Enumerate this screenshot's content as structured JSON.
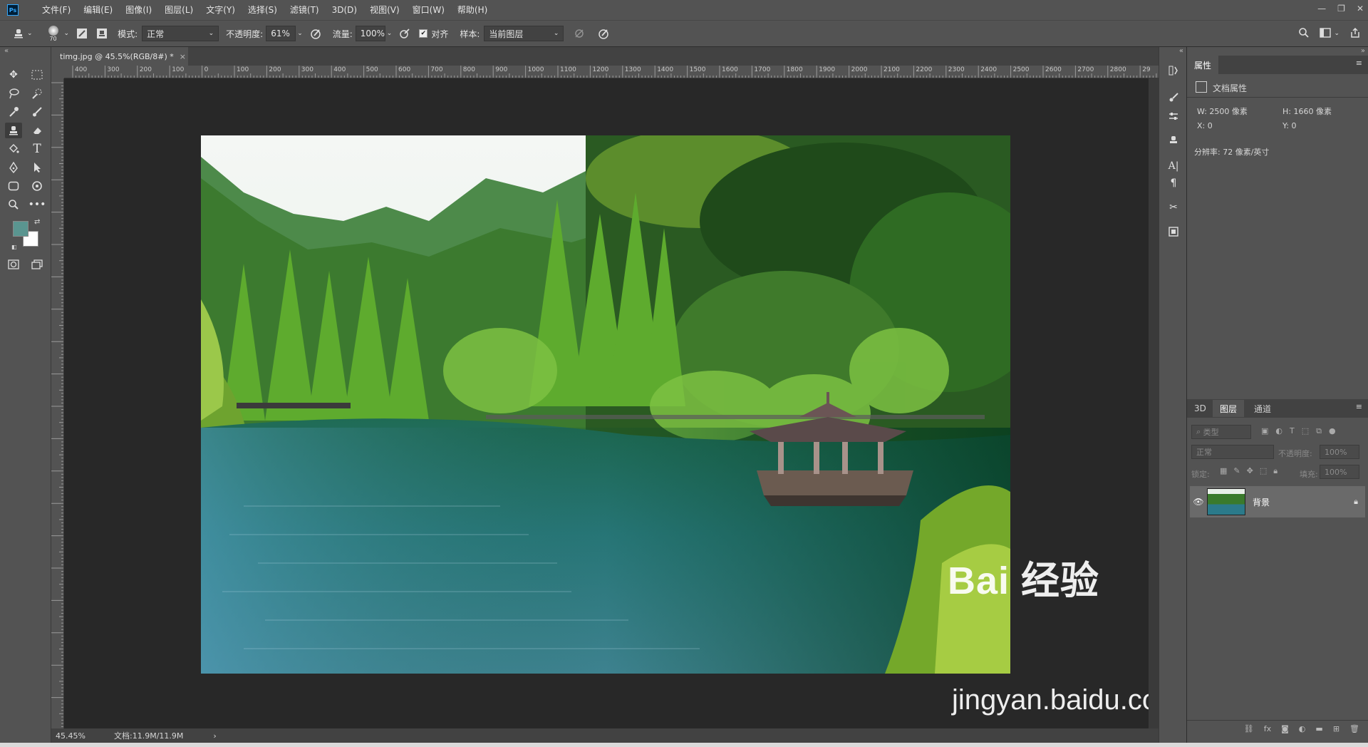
{
  "app": {
    "logo": "Ps"
  },
  "menu": [
    "文件(F)",
    "编辑(E)",
    "图像(I)",
    "图层(L)",
    "文字(Y)",
    "选择(S)",
    "滤镜(T)",
    "3D(D)",
    "视图(V)",
    "窗口(W)",
    "帮助(H)"
  ],
  "options": {
    "brush_size": "70",
    "mode_label": "模式:",
    "mode_value": "正常",
    "opacity_label": "不透明度:",
    "opacity_value": "61%",
    "flow_label": "流量:",
    "flow_value": "100%",
    "align_label": "对齐",
    "sample_label": "样本:",
    "sample_value": "当前图层"
  },
  "document": {
    "tab_title": "timg.jpg @ 45.5%(RGB/8#) *",
    "close": "×"
  },
  "ruler_top": [
    "400",
    "300",
    "200",
    "100",
    "0",
    "100",
    "200",
    "300",
    "400",
    "500",
    "600",
    "700",
    "800",
    "900",
    "1000",
    "1100",
    "1200",
    "1300",
    "1400",
    "1500",
    "1600",
    "1700",
    "1800",
    "1900",
    "2000",
    "2100",
    "2200",
    "2300",
    "2400",
    "2500",
    "2600",
    "2700",
    "2800",
    "29"
  ],
  "status": {
    "zoom": "45.45%",
    "doc_info": "文档:11.9M/11.9M",
    "arrow": "›"
  },
  "properties": {
    "tab": "属性",
    "section": "文档属性",
    "w": "W:  2500 像素",
    "h": "H:  1660 像素",
    "x": "X:  0",
    "y": "Y:  0",
    "resolution": "分辨率: 72 像素/英寸"
  },
  "layers_panel": {
    "tabs": [
      "3D",
      "图层",
      "通道"
    ],
    "active_tab": 1,
    "filter_placeholder": "类型",
    "blend_mode": "正常",
    "opacity_label": "不透明度:",
    "opacity_value": "100%",
    "lock_label": "锁定:",
    "fill_label": "填充:",
    "fill_value": "100%",
    "layers": [
      {
        "name": "背景",
        "visible": true,
        "locked": true
      }
    ]
  },
  "watermark": {
    "brand": "Bai 经验",
    "url": "jingyan.baidu.com"
  },
  "colors": {
    "foreground": "#5a9590",
    "background": "#ffffff",
    "accent": "#31a8ff"
  }
}
